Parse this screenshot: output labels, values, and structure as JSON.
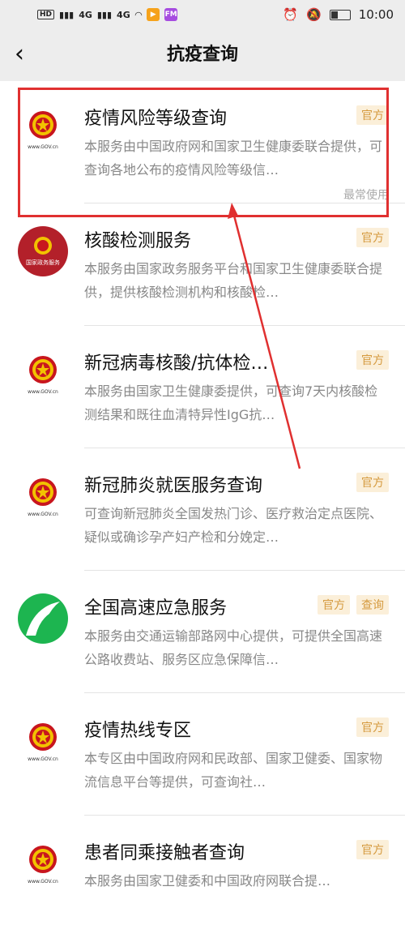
{
  "status": {
    "net1": "HD",
    "net2": "4G",
    "net3": "4G",
    "fm": "FM",
    "time": "10:00"
  },
  "header": {
    "back_icon": "‹",
    "title": "抗疫查询"
  },
  "list": [
    {
      "name": "疫情风险等级查询",
      "desc": "本服务由中国政府网和国家卫生健康委联合提供，可查询各地公布的疫情风险等级信…",
      "badges": [
        "官方"
      ],
      "recent": "最常使用",
      "logo": "emblem"
    },
    {
      "name": "核酸检测服务",
      "desc": "本服务由国家政务服务平台和国家卫生健康委联合提供，提供核酸检测机构和核酸检…",
      "badges": [
        "官方"
      ],
      "logo": "gov-service",
      "logo_text": "国家政务服务"
    },
    {
      "name": "新冠病毒核酸/抗体检…",
      "desc": "本服务由国家卫生健康委提供，可查询7天内核酸检测结果和既往血清特异性IgG抗…",
      "badges": [
        "官方"
      ],
      "logo": "emblem"
    },
    {
      "name": "新冠肺炎就医服务查询",
      "desc": "可查询新冠肺炎全国发热门诊、医疗救治定点医院、疑似或确诊孕产妇产检和分娩定…",
      "badges": [
        "官方"
      ],
      "logo": "emblem"
    },
    {
      "name": "全国高速应急服务",
      "desc": "本服务由交通运输部路网中心提供，可提供全国高速公路收费站、服务区应急保障信…",
      "badges": [
        "官方",
        "查询"
      ],
      "logo": "highway"
    },
    {
      "name": "疫情热线专区",
      "desc": "本专区由中国政府网和民政部、国家卫健委、国家物流信息平台等提供，可查询社…",
      "badges": [
        "官方"
      ],
      "logo": "emblem"
    },
    {
      "name": "患者同乘接触者查询",
      "desc": "本服务由国家卫健委和中国政府网联合提…",
      "badges": [
        "官方"
      ],
      "logo": "emblem"
    }
  ],
  "gov_caption": "www.GOV.cn",
  "colors": {
    "highlight": "#e03030",
    "badge_bg": "#fbefd9",
    "badge_text": "#d59a3e",
    "highway_green": "#1db550",
    "gov_red": "#b3202a"
  }
}
